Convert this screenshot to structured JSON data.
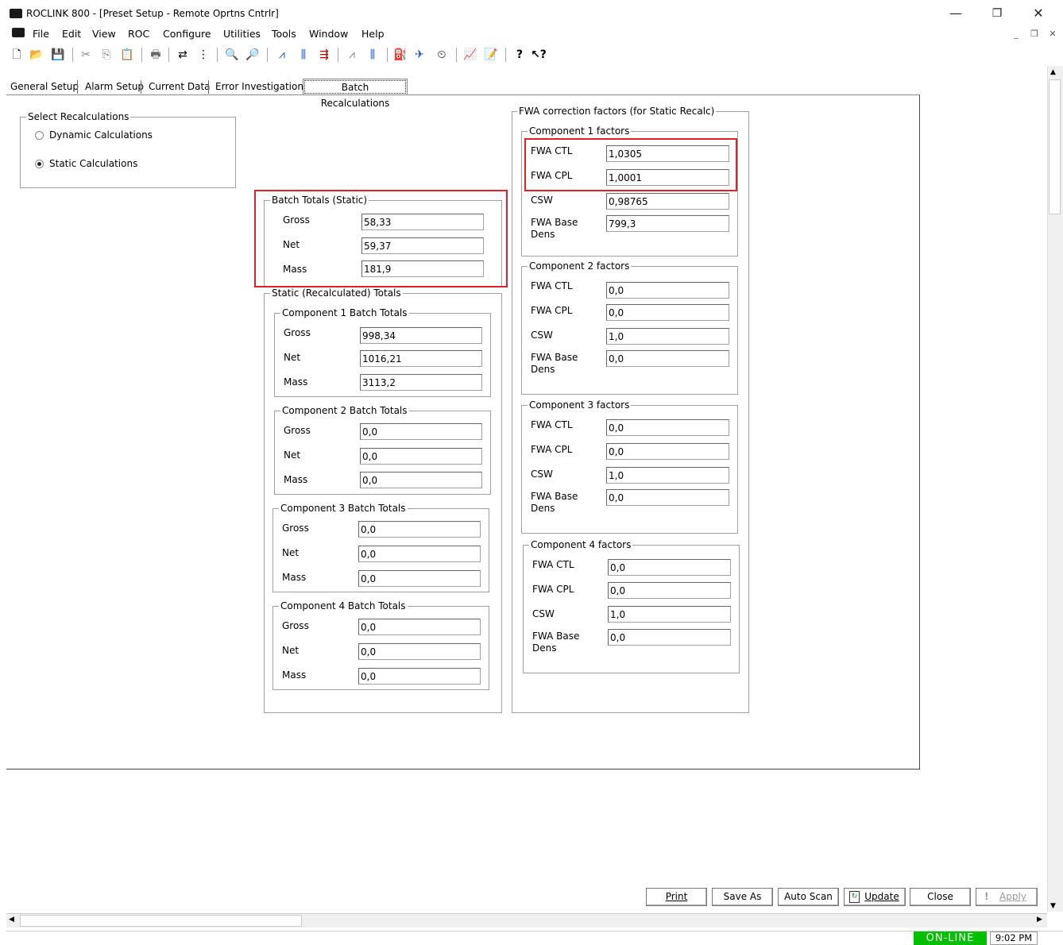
{
  "window": {
    "title": "ROCLINK 800 - [Preset Setup - Remote Oprtns Cntrlr]",
    "controls": {
      "minimize": "—",
      "restore": "❐",
      "close": "✕"
    }
  },
  "menu": [
    "File",
    "Edit",
    "View",
    "ROC",
    "Configure",
    "Utilities",
    "Tools",
    "Window",
    "Help"
  ],
  "tabs": [
    "General Setup",
    "Alarm Setup",
    "Current Data",
    "Error Investigation",
    "Batch Recalculations"
  ],
  "select_recalc": {
    "title": "Select Recalculations",
    "options": [
      {
        "label": "Dynamic Calculations",
        "selected": false
      },
      {
        "label": "Static Calculations",
        "selected": true
      }
    ]
  },
  "batch_totals_static": {
    "title": "Batch Totals (Static)",
    "gross_label": "Gross",
    "gross": "58,33",
    "net_label": "Net",
    "net": "59,37",
    "mass_label": "Mass",
    "mass": "181,9"
  },
  "static_recalc": {
    "title": "Static (Recalculated) Totals",
    "components": [
      {
        "title": "Component 1 Batch Totals",
        "gross": "998,34",
        "net": "1016,21",
        "mass": "3113,2"
      },
      {
        "title": "Component 2 Batch Totals",
        "gross": "0,0",
        "net": "0,0",
        "mass": "0,0"
      },
      {
        "title": "Component 3 Batch Totals",
        "gross": "0,0",
        "net": "0,0",
        "mass": "0,0"
      },
      {
        "title": "Component 4 Batch Totals",
        "gross": "0,0",
        "net": "0,0",
        "mass": "0,0"
      }
    ],
    "labels": {
      "gross": "Gross",
      "net": "Net",
      "mass": "Mass"
    }
  },
  "fwa": {
    "title": "FWA correction factors (for Static Recalc)",
    "labels": {
      "ctl": "FWA CTL",
      "cpl": "FWA CPL",
      "csw": "CSW",
      "base1": "FWA Base",
      "base2": "Dens"
    },
    "components": [
      {
        "title": "Component 1 factors",
        "ctl": "1,0305",
        "cpl": "1,0001",
        "csw": "0,98765",
        "base": "799,3"
      },
      {
        "title": "Component 2 factors",
        "ctl": "0,0",
        "cpl": "0,0",
        "csw": "1,0",
        "base": "0,0"
      },
      {
        "title": "Component 3 factors",
        "ctl": "0,0",
        "cpl": "0,0",
        "csw": "1,0",
        "base": "0,0"
      },
      {
        "title": "Component 4 factors",
        "ctl": "0,0",
        "cpl": "0,0",
        "csw": "1,0",
        "base": "0,0"
      }
    ]
  },
  "buttons": {
    "print": "Print",
    "save_as": "Save As",
    "auto_scan": "Auto Scan",
    "update": "Update",
    "close": "Close",
    "apply": "Apply"
  },
  "status": {
    "connection": "ON-LINE",
    "time": "9:02 PM"
  },
  "colors": {
    "highlight": "#e0202a",
    "online": "#00c000"
  }
}
